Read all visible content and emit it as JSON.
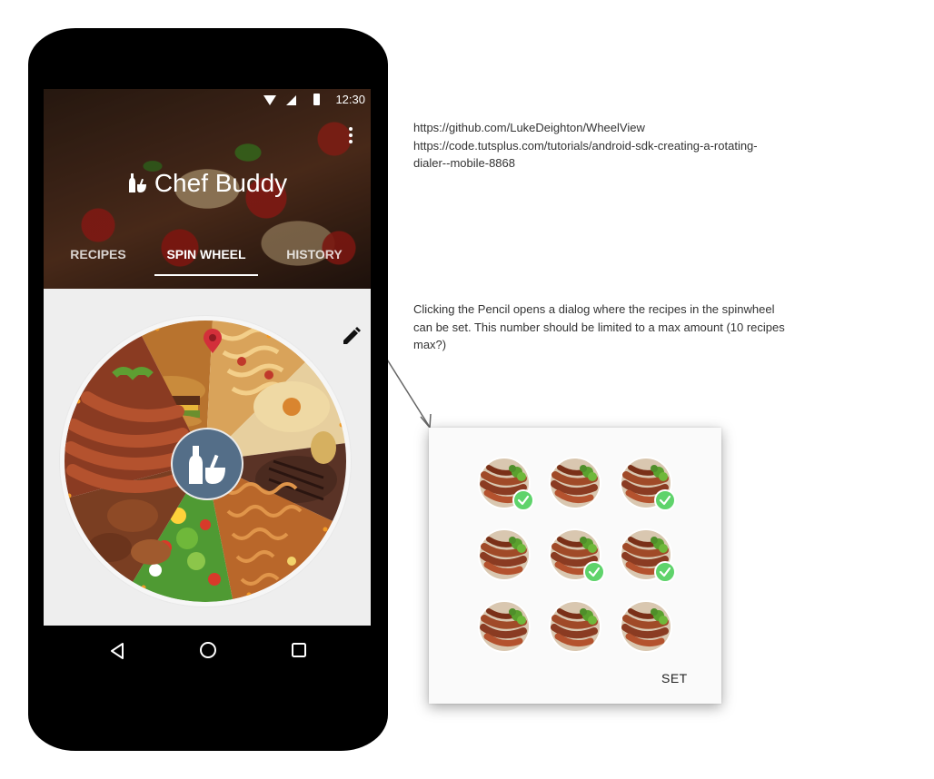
{
  "status_bar": {
    "time": "12:30"
  },
  "app": {
    "title": "Chef Buddy"
  },
  "tabs": [
    {
      "label": "RECIPES",
      "active": false
    },
    {
      "label": "SPIN WHEEL",
      "active": true
    },
    {
      "label": "HISTORY",
      "active": false
    }
  ],
  "wheel": {
    "segments": [
      "burger",
      "pasta",
      "hummus",
      "steak",
      "noodles",
      "salad",
      "fried chicken",
      "sausages"
    ],
    "hub_icon": "condiment-icon",
    "pointer_icon": "map-pin-icon",
    "edit_icon": "pencil-icon"
  },
  "notes": {
    "urls": "https://github.com/LukeDeighton/WheelView\nhttps://code.tutsplus.com/tutorials/android-sdk-creating-a-rotating-\ndialer--mobile-8868",
    "pencil": "Clicking the Pencil opens a dialog where the recipes in the spinwheel\ncan be set. This number should be limited to a max amount (10 recipes\nmax?)"
  },
  "dialog": {
    "recipes": [
      {
        "checked": true
      },
      {
        "checked": false
      },
      {
        "checked": true
      },
      {
        "checked": false
      },
      {
        "checked": true
      },
      {
        "checked": true
      },
      {
        "checked": false
      },
      {
        "checked": false
      },
      {
        "checked": false
      }
    ],
    "set_label": "SET"
  },
  "colors": {
    "hub": "#546e88",
    "check": "#5fd36b",
    "pointer": "#d32f3a",
    "tick": "#f19a26"
  }
}
